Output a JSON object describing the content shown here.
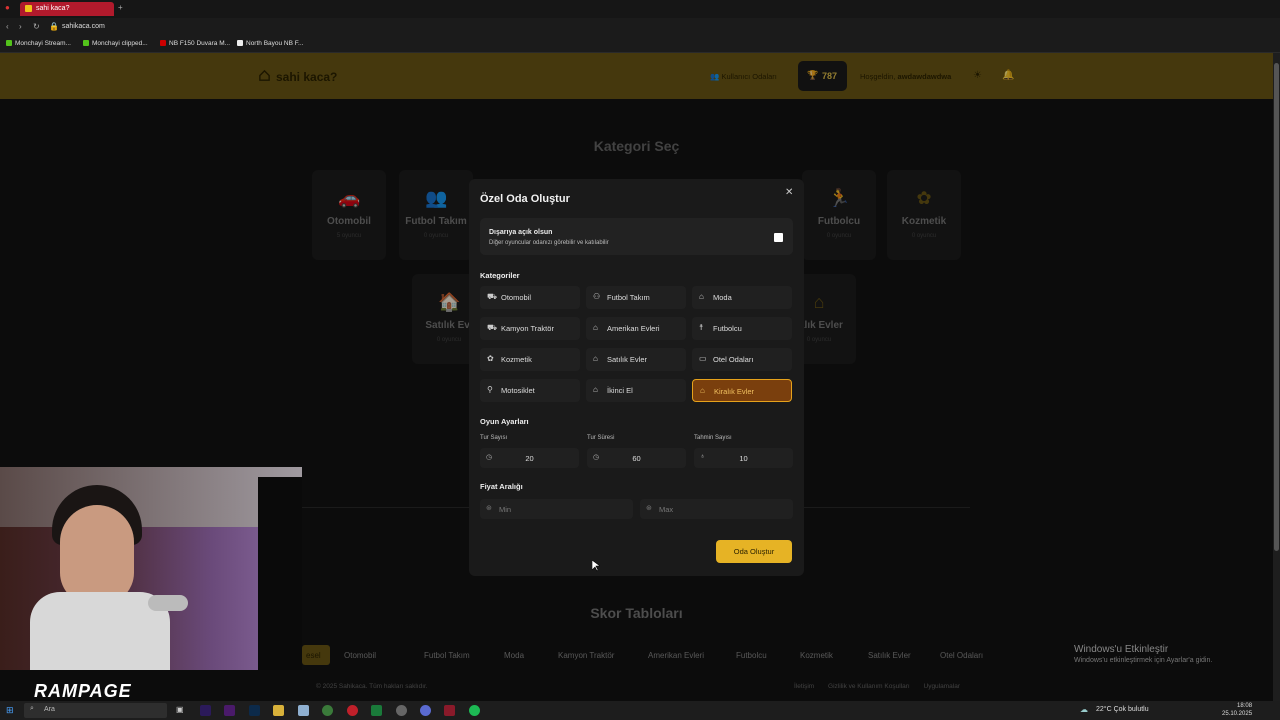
{
  "browser": {
    "tab_title": "sahi kaca?",
    "url": "sahikaca.com",
    "bookmarks": [
      "Monchayi Stream...",
      "Monchayi clipped...",
      "NB F150 Duvara M...",
      "North Bayou NB F..."
    ]
  },
  "header": {
    "logo": "sahi kaca?",
    "rooms_link": "Kullanıcı Odaları",
    "points": "787",
    "welcome_prefix": "Hoşgeldin,",
    "username": "awdawdawdwa"
  },
  "page": {
    "category_title": "Kategori Seç",
    "cards": [
      {
        "label": "Otomobil",
        "sub": "5 oyuncu"
      },
      {
        "label": "Futbol Takım",
        "sub": "0 oyuncu"
      },
      {
        "label": "Futbolcu",
        "sub": "0 oyuncu"
      },
      {
        "label": "Kozmetik",
        "sub": "0 oyuncu"
      },
      {
        "label": "Satılık Evl",
        "sub": "0 oyuncu"
      },
      {
        "label": "ralık Evler",
        "sub": "0 oyuncu"
      }
    ],
    "score_title": "Skor Tabloları",
    "score_tabs": [
      "esel",
      "Otomobil",
      "Futbol Takım",
      "Moda",
      "Kamyon Traktör",
      "Amerikan Evleri",
      "Futbolcu",
      "Kozmetik",
      "Satılık Evler",
      "Otel Odaları"
    ],
    "footer_copy": "© 2025 Sahikaca. Tüm hakları saklıdır.",
    "footer_links": [
      "İletişim",
      "Gizlilik ve Kullanım Koşulları",
      "Uygulamalar"
    ]
  },
  "modal": {
    "title": "Özel Oda Oluştur",
    "close": "✕",
    "public_title": "Dışarıya açık olsun",
    "public_desc": "Diğer oyuncular odanızı görebilir ve katılabilir",
    "categories_label": "Kategoriler",
    "categories": [
      {
        "label": "Otomobil",
        "icon": "car-icon"
      },
      {
        "label": "Futbol Takım",
        "icon": "users-icon"
      },
      {
        "label": "Moda",
        "icon": "basket-icon"
      },
      {
        "label": "Kamyon Traktör",
        "icon": "truck-icon"
      },
      {
        "label": "Amerikan Evleri",
        "icon": "house-icon"
      },
      {
        "label": "Futbolcu",
        "icon": "person-icon"
      },
      {
        "label": "Kozmetik",
        "icon": "flower-icon"
      },
      {
        "label": "Satılık Evler",
        "icon": "house-plus-icon"
      },
      {
        "label": "Otel Odaları",
        "icon": "bed-icon"
      },
      {
        "label": "Motosiklet",
        "icon": "bike-icon"
      },
      {
        "label": "İkinci El",
        "icon": "basket-icon"
      },
      {
        "label": "Kiralık Evler",
        "icon": "house-icon",
        "selected": true
      }
    ],
    "settings_label": "Oyun Ayarları",
    "round_count_label": "Tur Sayısı",
    "round_count": "20",
    "round_time_label": "Tur Süresi",
    "round_time": "60",
    "guess_count_label": "Tahmin Sayısı",
    "guess_count": "10",
    "price_label": "Fiyat Aralığı",
    "min_placeholder": "Min",
    "max_placeholder": "Max",
    "create_button": "Oda Oluştur"
  },
  "stream": {
    "overlay_brand": "RAMPAGE"
  },
  "windows": {
    "activate_title": "Windows'u Etkinleştir",
    "activate_desc": "Windows'u etkinleştirmek için Ayarlar'a gidin.",
    "search_placeholder": "Ara",
    "weather": "22°C Çok bulutlu",
    "time": "18:08",
    "date": "25.10.2025"
  },
  "colors": {
    "accent": "#e6b325",
    "header_bg": "#6b5714",
    "selected_bg": "#7a3f0d"
  }
}
